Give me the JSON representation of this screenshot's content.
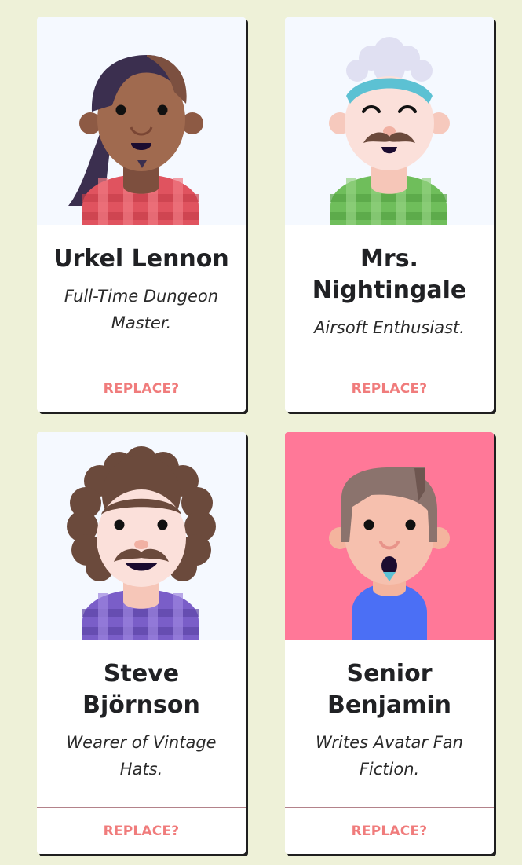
{
  "cards": [
    {
      "name": "Urkel Lennon",
      "role": "Full-Time Dungeon Master.",
      "action": "REPLACE?",
      "avatar_bg": "#f5f9ff"
    },
    {
      "name": "Mrs. Nightingale",
      "role": "Airsoft Enthusiast.",
      "action": "REPLACE?",
      "avatar_bg": "#f5f9ff"
    },
    {
      "name": "Steve Björnson",
      "role": "Wearer of Vintage Hats.",
      "action": "REPLACE?",
      "avatar_bg": "#f5f9ff"
    },
    {
      "name": "Senior Benjamin",
      "role": "Writes Avatar Fan Fiction.",
      "action": "REPLACE?",
      "avatar_bg": "#ff7898"
    }
  ],
  "colors": {
    "page_bg": "#eef1d8",
    "action": "#f07c7c",
    "divider": "#b3828a"
  }
}
